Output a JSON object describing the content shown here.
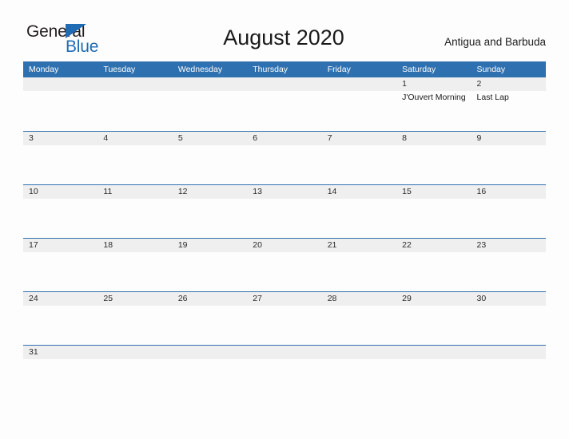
{
  "logo": {
    "word_one": "General",
    "word_two": "Blue",
    "triangle_color": "#1f6cb4",
    "text_color": "#231f20"
  },
  "header": {
    "title": "August 2020",
    "subtitle": "Antigua and Barbuda"
  },
  "colors": {
    "header_blue": "#2f71b0",
    "band_gray": "#efefef",
    "page_background": "#fdfdfd",
    "text_dark": "#1a1a1a",
    "text_white": "#ffffff"
  },
  "calendar": {
    "day_headers": [
      "Monday",
      "Tuesday",
      "Wednesday",
      "Thursday",
      "Friday",
      "Saturday",
      "Sunday"
    ],
    "weeks": [
      {
        "days": [
          {
            "num": "",
            "events": []
          },
          {
            "num": "",
            "events": []
          },
          {
            "num": "",
            "events": []
          },
          {
            "num": "",
            "events": []
          },
          {
            "num": "",
            "events": []
          },
          {
            "num": "1",
            "events": [
              "J'Ouvert Morning"
            ]
          },
          {
            "num": "2",
            "events": [
              "Last Lap"
            ]
          }
        ]
      },
      {
        "days": [
          {
            "num": "3",
            "events": []
          },
          {
            "num": "4",
            "events": []
          },
          {
            "num": "5",
            "events": []
          },
          {
            "num": "6",
            "events": []
          },
          {
            "num": "7",
            "events": []
          },
          {
            "num": "8",
            "events": []
          },
          {
            "num": "9",
            "events": []
          }
        ]
      },
      {
        "days": [
          {
            "num": "10",
            "events": []
          },
          {
            "num": "11",
            "events": []
          },
          {
            "num": "12",
            "events": []
          },
          {
            "num": "13",
            "events": []
          },
          {
            "num": "14",
            "events": []
          },
          {
            "num": "15",
            "events": []
          },
          {
            "num": "16",
            "events": []
          }
        ]
      },
      {
        "days": [
          {
            "num": "17",
            "events": []
          },
          {
            "num": "18",
            "events": []
          },
          {
            "num": "19",
            "events": []
          },
          {
            "num": "20",
            "events": []
          },
          {
            "num": "21",
            "events": []
          },
          {
            "num": "22",
            "events": []
          },
          {
            "num": "23",
            "events": []
          }
        ]
      },
      {
        "days": [
          {
            "num": "24",
            "events": []
          },
          {
            "num": "25",
            "events": []
          },
          {
            "num": "26",
            "events": []
          },
          {
            "num": "27",
            "events": []
          },
          {
            "num": "28",
            "events": []
          },
          {
            "num": "29",
            "events": []
          },
          {
            "num": "30",
            "events": []
          }
        ]
      },
      {
        "days": [
          {
            "num": "31",
            "events": []
          },
          {
            "num": "",
            "events": []
          },
          {
            "num": "",
            "events": []
          },
          {
            "num": "",
            "events": []
          },
          {
            "num": "",
            "events": []
          },
          {
            "num": "",
            "events": []
          },
          {
            "num": "",
            "events": []
          }
        ]
      }
    ]
  }
}
